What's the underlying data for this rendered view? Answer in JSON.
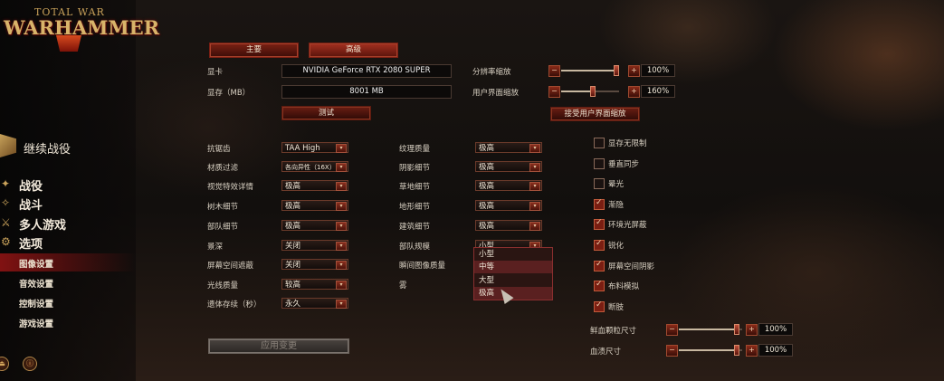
{
  "logo": {
    "top": "TOTAL WAR",
    "main": "WARHAMMER"
  },
  "sidebar": {
    "continue": "继续战役",
    "items": [
      {
        "label": "战役",
        "icon": "campaign-icon"
      },
      {
        "label": "战斗",
        "icon": "battle-icon"
      },
      {
        "label": "多人游戏",
        "icon": "multiplayer-icon"
      },
      {
        "label": "选项",
        "icon": "options-icon"
      }
    ],
    "sub_items": [
      "图像设置",
      "音效设置",
      "控制设置",
      "游戏设置"
    ],
    "bottom_icons": [
      "exit-icon",
      "info-icon"
    ]
  },
  "tabs": {
    "basic": "主要",
    "advanced": "高级"
  },
  "gpu": {
    "label": "显卡",
    "value": "NVIDIA GeForce RTX 2080 SUPER"
  },
  "vram": {
    "label": "显存（MB）",
    "value": "8001 MB"
  },
  "test_button": "测试",
  "resolution_scale": {
    "label": "分辨率缩放",
    "value": "100%",
    "fraction": 0.95
  },
  "ui_scale": {
    "label": "用户界面缩放",
    "value": "160%",
    "fraction": 0.55
  },
  "accept_ui_scale_button": "接受用户界面缩放",
  "settings_col1": [
    {
      "label": "抗锯齿",
      "value": "TAA High"
    },
    {
      "label": "材质过滤",
      "value": "各向异性（16X）"
    },
    {
      "label": "视觉特效详情",
      "value": "极高"
    },
    {
      "label": "树木细节",
      "value": "极高"
    },
    {
      "label": "部队细节",
      "value": "极高"
    },
    {
      "label": "景深",
      "value": "关闭"
    },
    {
      "label": "屏幕空间遮蔽",
      "value": "关闭"
    },
    {
      "label": "光线质量",
      "value": "较高"
    },
    {
      "label": "遗体存续（秒）",
      "value": "永久"
    }
  ],
  "settings_col2": [
    {
      "label": "纹理质量",
      "value": "极高"
    },
    {
      "label": "阴影细节",
      "value": "极高"
    },
    {
      "label": "草地细节",
      "value": "极高"
    },
    {
      "label": "地形细节",
      "value": "极高"
    },
    {
      "label": "建筑细节",
      "value": "极高"
    },
    {
      "label": "部队规模",
      "value": "小型"
    },
    {
      "label": "瞬间图像质量",
      "value": ""
    },
    {
      "label": "雾",
      "value": ""
    }
  ],
  "unit_size_options": [
    "小型",
    "中等",
    "大型",
    "极高"
  ],
  "checkboxes": [
    {
      "label": "显存无限制",
      "checked": false
    },
    {
      "label": "垂直同步",
      "checked": false
    },
    {
      "label": "晕光",
      "checked": false
    },
    {
      "label": "渐隐",
      "checked": true
    },
    {
      "label": "环境光屏蔽",
      "checked": true
    },
    {
      "label": "锐化",
      "checked": true
    },
    {
      "label": "屏幕空间阴影",
      "checked": true
    },
    {
      "label": "布料模拟",
      "checked": true
    },
    {
      "label": "断肢",
      "checked": true
    }
  ],
  "blood_particle": {
    "label": "鲜血颗粒尺寸",
    "value": "100%",
    "fraction": 0.92
  },
  "blood_decal": {
    "label": "血渍尺寸",
    "value": "100%",
    "fraction": 0.92
  },
  "apply_button": "应用变更"
}
